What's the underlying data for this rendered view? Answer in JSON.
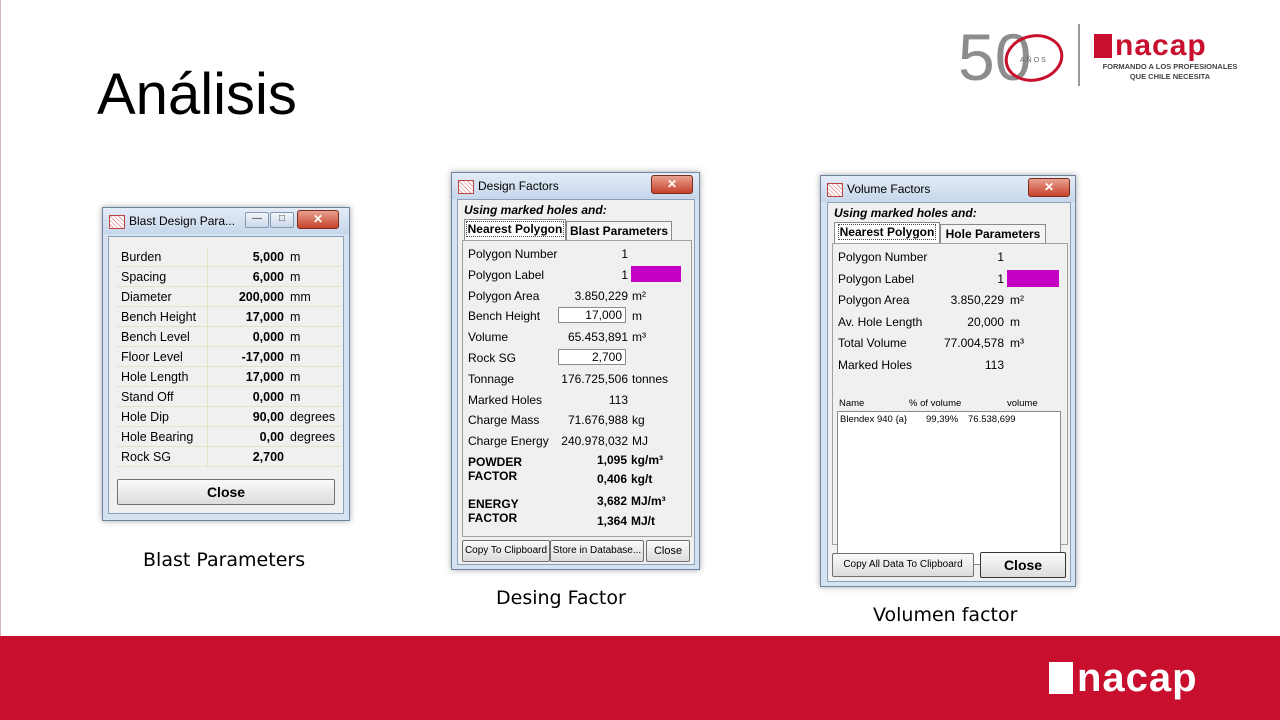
{
  "slide": {
    "title": "Análisis",
    "captions": {
      "blast": "Blast Parameters",
      "design": "Desing Factor",
      "volume": "Volumen factor"
    }
  },
  "branding": {
    "logo_50": "50",
    "logo_50_sub": "AÑOS",
    "inacap_word": "nacap",
    "tagline_1": "FORMANDO A LOS PROFESIONALES",
    "tagline_2": "QUE CHILE NECESITA",
    "footer_word": "nacap",
    "brand_color": "#c8102e"
  },
  "blast_window": {
    "title": "Blast Design Para...",
    "rows": [
      {
        "label": "Burden",
        "value": "5,000",
        "unit": "m"
      },
      {
        "label": "Spacing",
        "value": "6,000",
        "unit": "m"
      },
      {
        "label": "Diameter",
        "value": "200,000",
        "unit": "mm"
      },
      {
        "label": "Bench Height",
        "value": "17,000",
        "unit": "m"
      },
      {
        "label": "Bench Level",
        "value": "0,000",
        "unit": "m"
      },
      {
        "label": "Floor Level",
        "value": "-17,000",
        "unit": "m"
      },
      {
        "label": "Hole Length",
        "value": "17,000",
        "unit": "m"
      },
      {
        "label": "Stand Off",
        "value": "0,000",
        "unit": "m"
      },
      {
        "label": "Hole Dip",
        "value": "90,00",
        "unit": "degrees"
      },
      {
        "label": "Hole Bearing",
        "value": "0,00",
        "unit": "degrees"
      },
      {
        "label": "Rock SG",
        "value": "2,700",
        "unit": ""
      }
    ],
    "close_label": "Close",
    "minimize_icon": "minimize-icon",
    "maximize_icon": "maximize-icon"
  },
  "design_window": {
    "title": "Design Factors",
    "heading": "Using marked holes and:",
    "tabs": [
      "Nearest Polygon",
      "Blast Parameters"
    ],
    "rows": [
      {
        "label": "Polygon Number",
        "value": "1",
        "unit": ""
      },
      {
        "label": "Polygon Label",
        "value": "1",
        "unit": ""
      },
      {
        "label": "Polygon Area",
        "value": "3.850,229",
        "unit": "m²"
      },
      {
        "label": "Bench Height",
        "value": "17,000",
        "unit": "m"
      },
      {
        "label": "Volume",
        "value": "65.453,891",
        "unit": "m³"
      },
      {
        "label": "Rock SG",
        "value": "2,700",
        "unit": ""
      },
      {
        "label": "Tonnage",
        "value": "176.725,506",
        "unit": "tonnes"
      },
      {
        "label": "Marked Holes",
        "value": "113",
        "unit": ""
      },
      {
        "label": "Charge Mass",
        "value": "71.676,988",
        "unit": "kg"
      },
      {
        "label": "Charge Energy",
        "value": "240.978,032",
        "unit": "MJ"
      }
    ],
    "powder_factor": {
      "label_1": "POWDER",
      "label_2": "FACTOR",
      "v1": "1,095",
      "u1": "kg/m³",
      "v2": "0,406",
      "u2": "kg/t"
    },
    "energy_factor": {
      "label_1": "ENERGY",
      "label_2": "FACTOR",
      "v1": "3,682",
      "u1": "MJ/m³",
      "v2": "1,364",
      "u2": "MJ/t"
    },
    "buttons": {
      "copy": "Copy To Clipboard",
      "store": "Store in Database...",
      "close": "Close"
    },
    "swatch_color": "#c400c4"
  },
  "volume_window": {
    "title": "Volume Factors",
    "heading": "Using marked holes and:",
    "tabs": [
      "Nearest Polygon",
      "Hole Parameters"
    ],
    "rows": [
      {
        "label": "Polygon Number",
        "value": "1",
        "unit": ""
      },
      {
        "label": "Polygon Label",
        "value": "1",
        "unit": ""
      },
      {
        "label": "Polygon Area",
        "value": "3.850,229",
        "unit": "m²"
      },
      {
        "label": "Av. Hole Length",
        "value": "20,000",
        "unit": "m"
      },
      {
        "label": "Total Volume",
        "value": "77.004,578",
        "unit": "m³"
      },
      {
        "label": "Marked Holes",
        "value": "113",
        "unit": ""
      }
    ],
    "table": {
      "headers": [
        "Name",
        "% of volume",
        "volume"
      ],
      "rows": [
        [
          "Blendex 940 {a}",
          "99,39%",
          "76.538,699"
        ]
      ]
    },
    "buttons": {
      "copy": "Copy All Data To Clipboard",
      "close": "Close"
    },
    "swatch_color": "#c400c4"
  }
}
